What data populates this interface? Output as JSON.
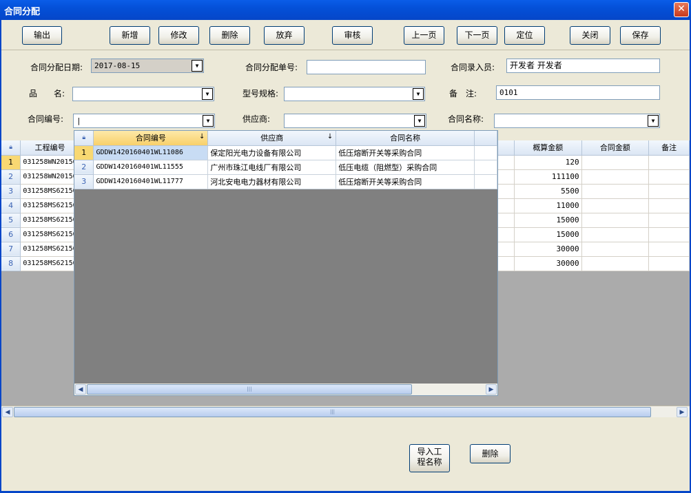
{
  "window": {
    "title": "合同分配",
    "close_glyph": "✕"
  },
  "toolbar": {
    "buttons": [
      "输出",
      "新增",
      "修改",
      "删除",
      "放弃",
      "审核",
      "上一页",
      "下一页",
      "定位",
      "关闭",
      "保存"
    ]
  },
  "form": {
    "date_label": "合同分配日期:",
    "date_value": "2017-08-15",
    "order_no_label": "合同分配单号:",
    "order_no_value": "",
    "recorder_label": "合同录入员:",
    "recorder_value": "开发者 开发者",
    "product_label": "品　　名:",
    "product_value": "",
    "model_label": "型号规格:",
    "model_value": "",
    "remark_label": "备　注:",
    "remark_value": "0101",
    "contract_no_label": "合同编号:",
    "contract_no_value": "|",
    "supplier_label": "供应商:",
    "supplier_value": "",
    "contract_name_label": "合同名称:",
    "contract_name_value": ""
  },
  "grid": {
    "columns": [
      "工程编号",
      "概算金额",
      "合同金额",
      "备注"
    ],
    "rows": [
      {
        "n": "1",
        "code": "031258WN20150",
        "amount": "120"
      },
      {
        "n": "2",
        "code": "031258WN20150",
        "amount": "111100"
      },
      {
        "n": "3",
        "code": "031258MS62150",
        "amount": "5500"
      },
      {
        "n": "4",
        "code": "031258MS62150",
        "amount": "11000"
      },
      {
        "n": "5",
        "code": "031258MS62150",
        "amount": "15000"
      },
      {
        "n": "6",
        "code": "031258MS62150",
        "amount": "15000"
      },
      {
        "n": "7",
        "code": "031258MS62150",
        "amount": "30000"
      },
      {
        "n": "8",
        "code": "031258MS62150",
        "amount": "30000"
      }
    ]
  },
  "popup": {
    "columns": [
      "合同编号",
      "供应商",
      "合同名称"
    ],
    "rows": [
      {
        "n": "1",
        "no": "GDDW1420160401WL11086",
        "supplier": "保定阳光电力设备有限公司",
        "name": "低压熔断开关等采购合同"
      },
      {
        "n": "2",
        "no": "GDDW1420160401WL11555",
        "supplier": "广州市珠江电线厂有限公司",
        "name": "低压电缆（阻燃型）采购合同"
      },
      {
        "n": "3",
        "no": "GDDW1420160401WL11777",
        "supplier": "河北安电电力器材有限公司",
        "name": "低压熔断开关等采购合同"
      }
    ]
  },
  "bottom": {
    "import_label": "导入工程名称",
    "delete_label": "删除"
  }
}
